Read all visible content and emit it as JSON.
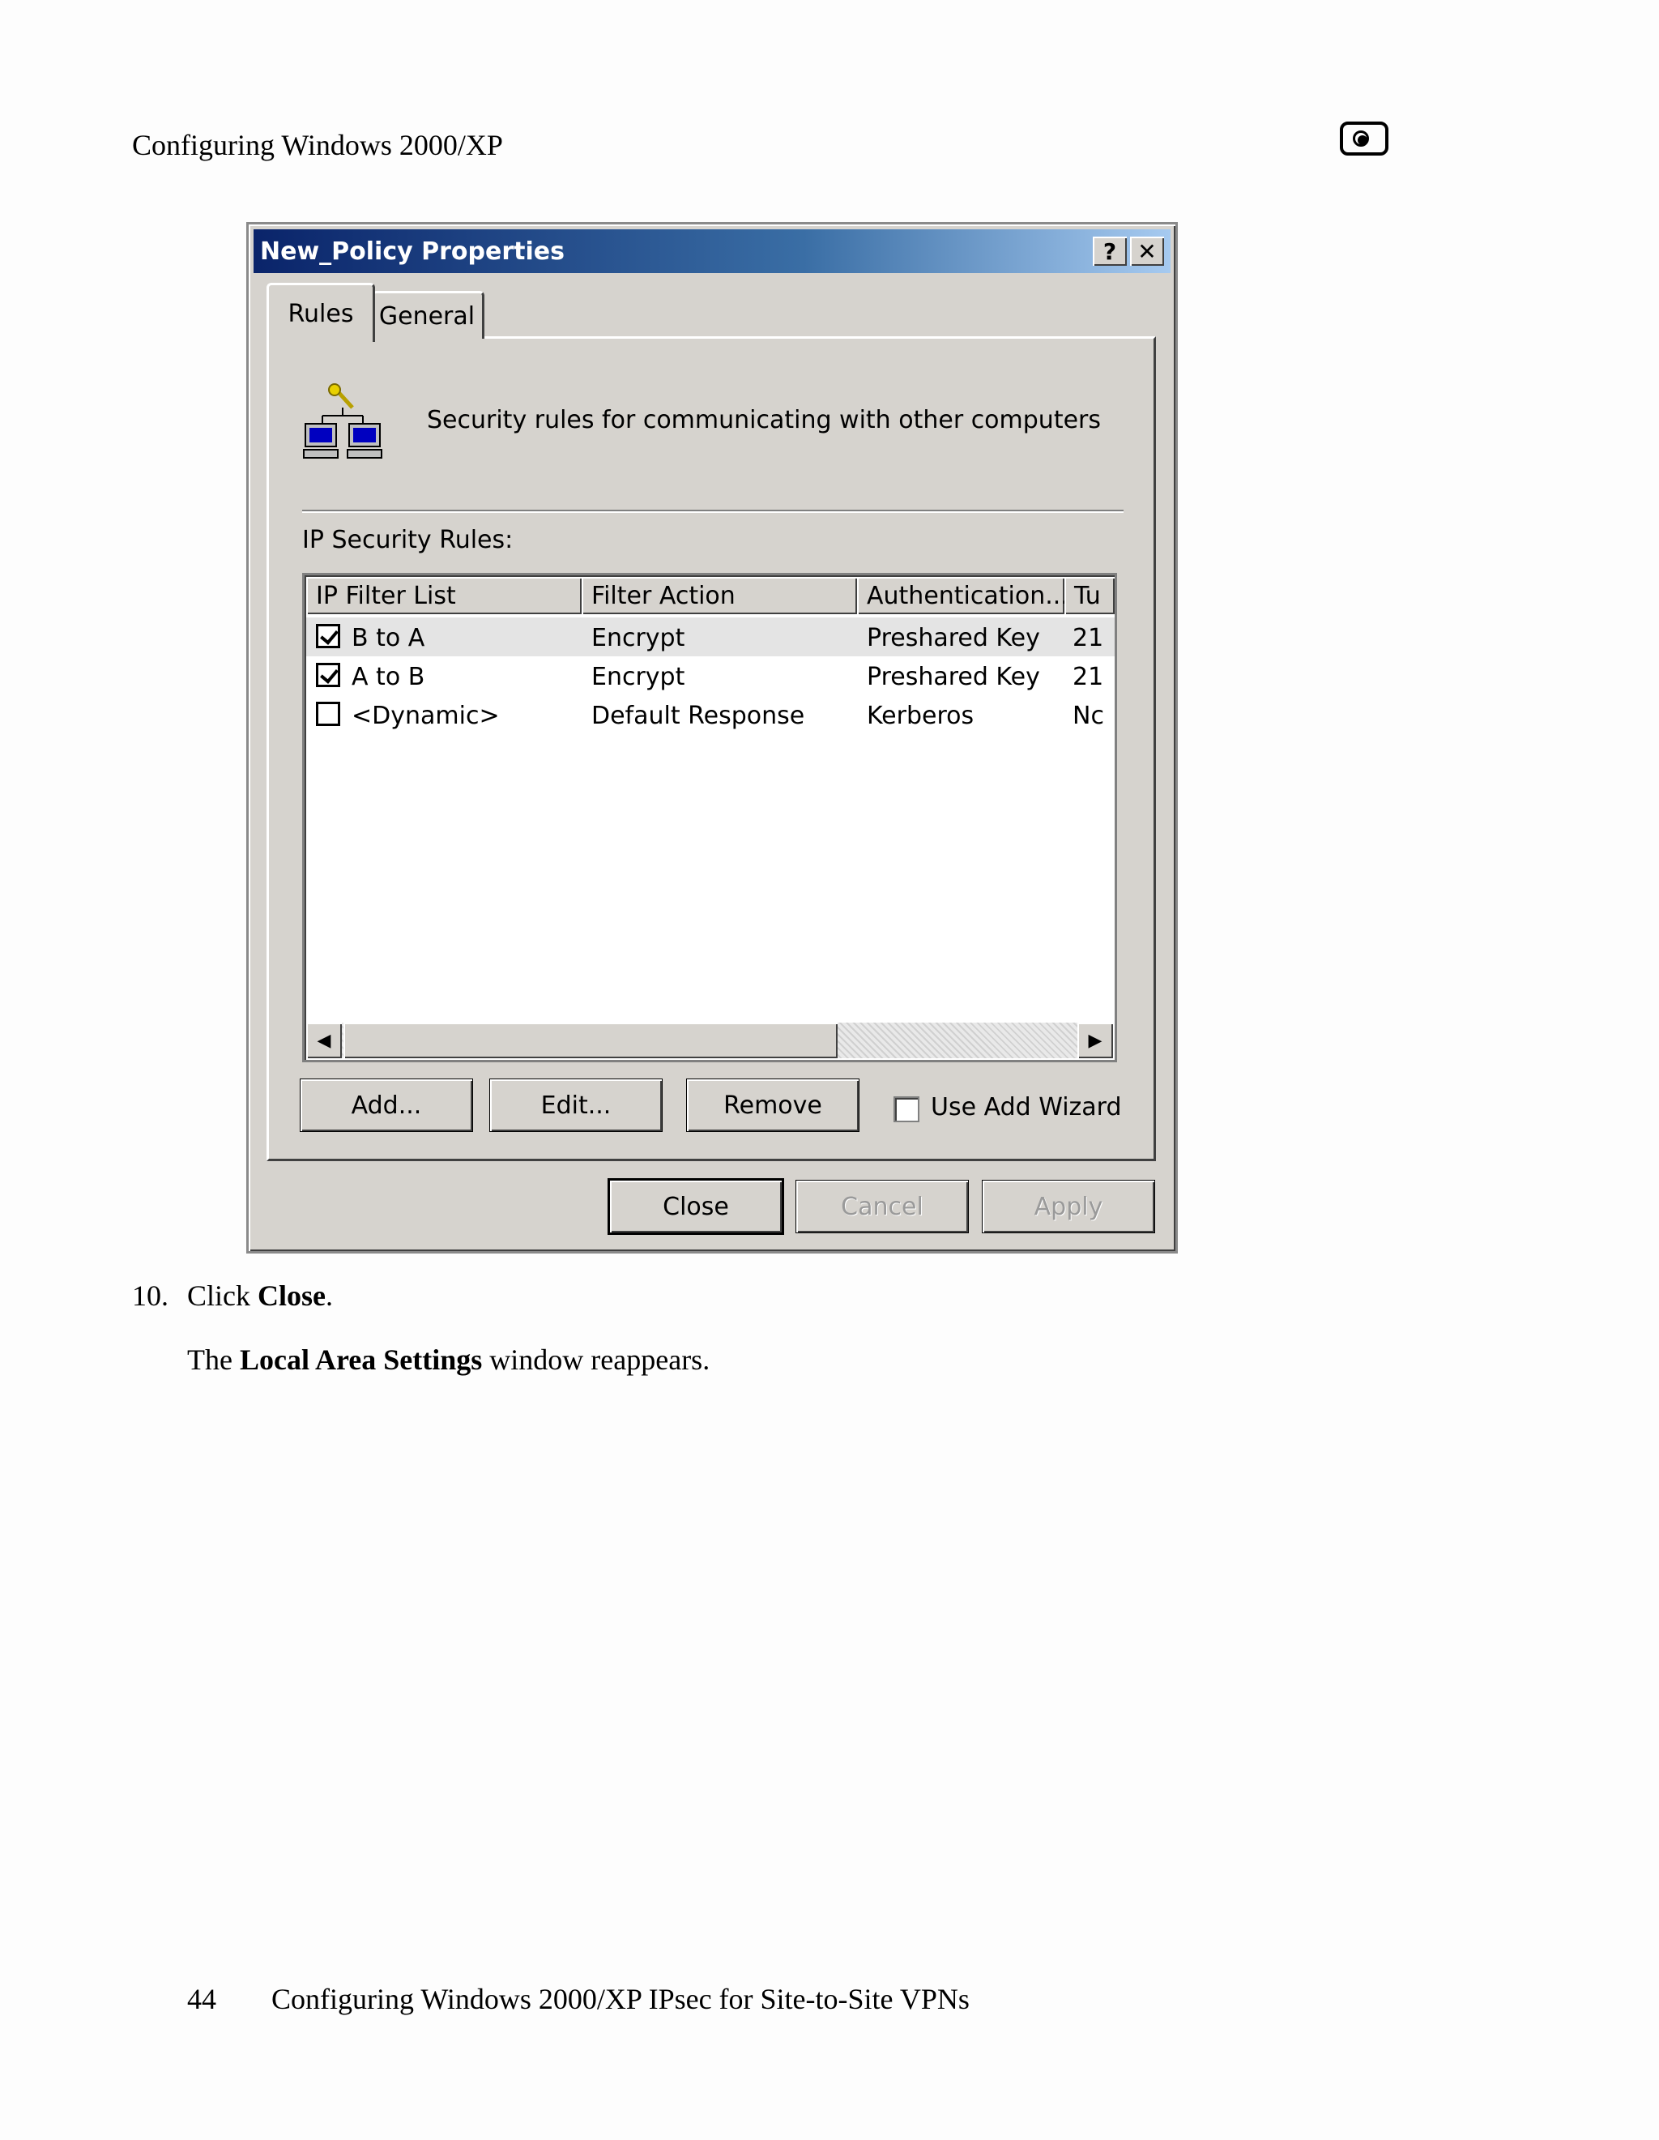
{
  "page": {
    "header": "Configuring Windows 2000/XP",
    "logo_icon": "product-logo-icon",
    "step_number": "10.",
    "step_text_prefix": "Click ",
    "step_text_bold": "Close",
    "step_text_suffix": ".",
    "para_prefix": "The ",
    "para_bold": "Local Area Settings",
    "para_suffix": " window reappears.",
    "footer_page": "44",
    "footer_title": "Configuring Windows 2000/XP IPsec for Site-to-Site VPNs"
  },
  "dialog": {
    "title": "New_Policy Properties",
    "help_button": "?",
    "close_button": "✕",
    "tabs": [
      {
        "label": "Rules",
        "active": true
      },
      {
        "label": "General",
        "active": false
      }
    ],
    "description": "Security rules for communicating with other computers",
    "rules_label": "IP Security Rules:",
    "columns": [
      "IP Filter List",
      "Filter Action",
      "Authentication...",
      "Tu"
    ],
    "rows": [
      {
        "checked": true,
        "filter_list": "B to A",
        "filter_action": "Encrypt",
        "authentication": "Preshared Key",
        "tunnel": "21"
      },
      {
        "checked": true,
        "filter_list": "A to B",
        "filter_action": "Encrypt",
        "authentication": "Preshared Key",
        "tunnel": "21"
      },
      {
        "checked": false,
        "filter_list": "<Dynamic>",
        "filter_action": "Default Response",
        "authentication": "Kerberos",
        "tunnel": "Nc"
      }
    ],
    "buttons": {
      "add": "Add...",
      "edit": "Edit...",
      "remove": "Remove",
      "use_add_wizard": "Use Add Wizard",
      "close": "Close",
      "cancel": "Cancel",
      "apply": "Apply"
    },
    "use_add_wizard_checked": false,
    "colors": {
      "titlebar_start": "#0a246a",
      "titlebar_end": "#a6caf0",
      "face": "#d6d3ce"
    }
  }
}
